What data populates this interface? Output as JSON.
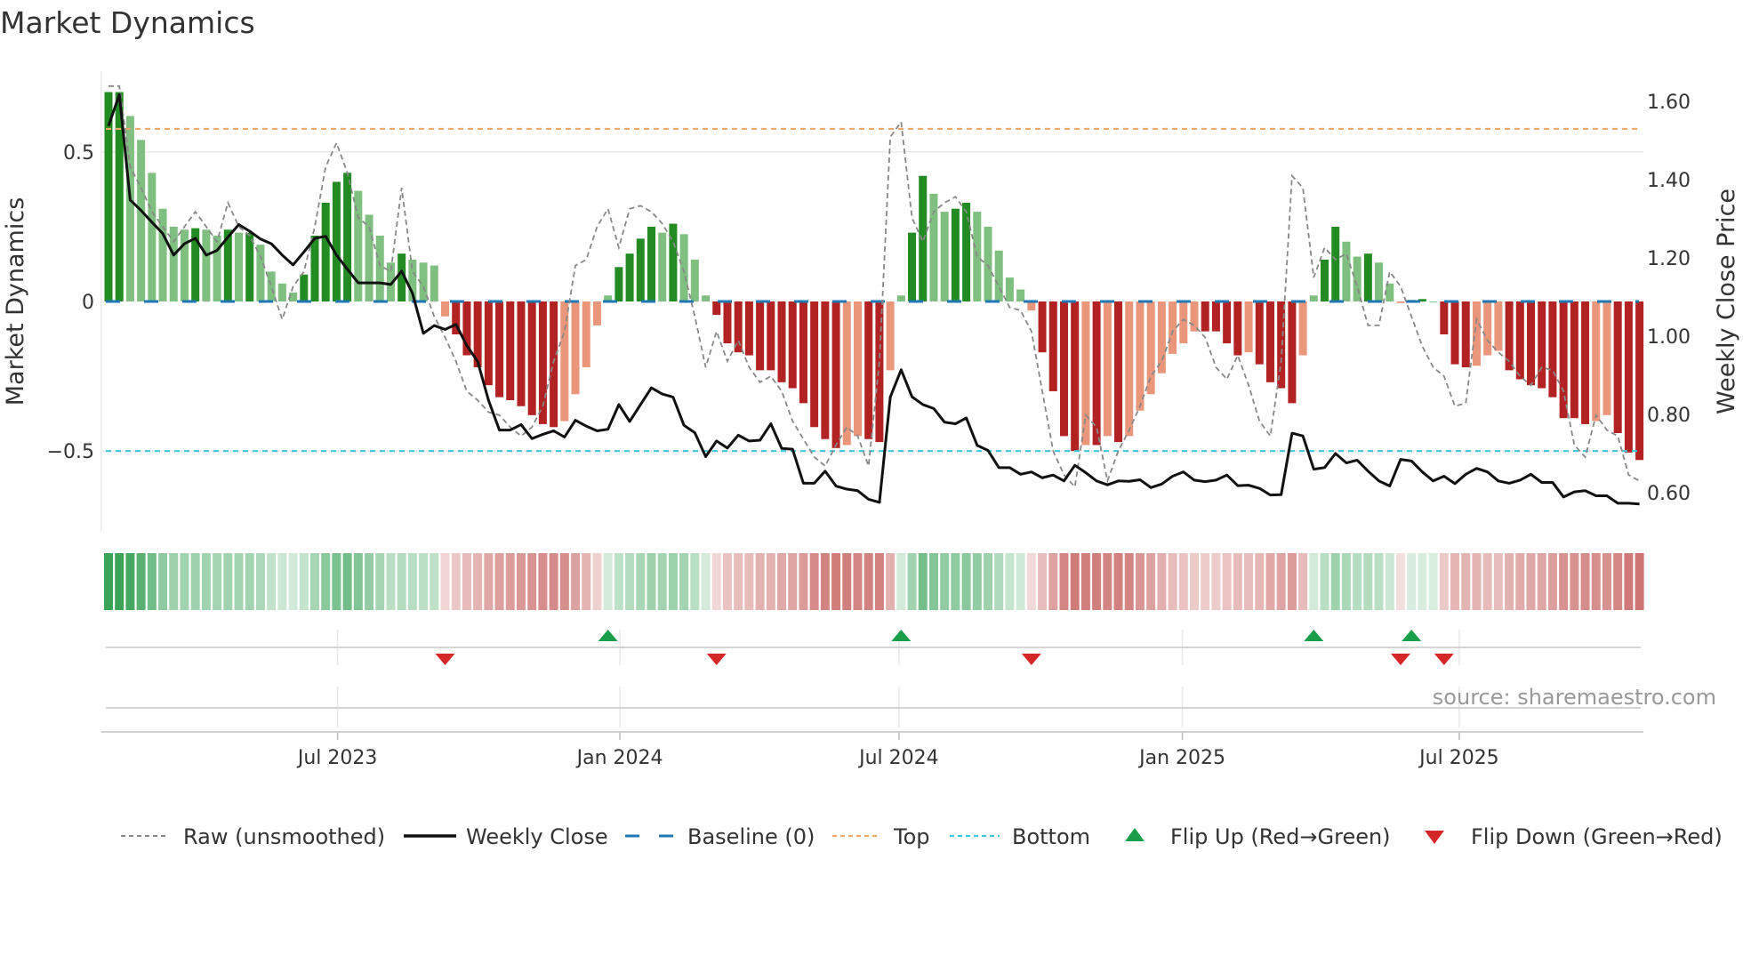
{
  "title": "Market Dynamics",
  "source": "source: sharemaestro.com",
  "colors": {
    "up_strong": "#228b22",
    "up_weak": "#7fbf7f",
    "down_strong": "#b22222",
    "down_weak": "#e9967a",
    "close": "#111111",
    "raw": "#888888",
    "baseline": "#1f77b4",
    "top": "#f0a868",
    "bottom": "#3cc8d8",
    "flip_up": "#1a9e4a",
    "flip_down": "#d62728",
    "strip_green": "#2e9e4f",
    "strip_red": "#c0504d"
  },
  "chart_data": {
    "type": "bar",
    "title": "Market Dynamics",
    "ylabel": "Market Dynamics",
    "ylabel_right": "Weekly Close Price",
    "ylim": [
      -0.77,
      0.77
    ],
    "ylim_right": [
      0.5,
      1.677
    ],
    "yticks": [
      {
        "value": 0.5,
        "label": "0.5"
      },
      {
        "value": 0,
        "label": "0"
      },
      {
        "value": -0.5,
        "label": "−0.5"
      }
    ],
    "yticks_right": [
      {
        "value": 1.6,
        "label": "1.60"
      },
      {
        "value": 1.4,
        "label": "1.40"
      },
      {
        "value": 1.2,
        "label": "1.20"
      },
      {
        "value": 1.0,
        "label": "1.00"
      },
      {
        "value": 0.8,
        "label": "0.80"
      },
      {
        "value": 0.6,
        "label": "0.60"
      }
    ],
    "x_unit": "week index",
    "x_ticks": [
      {
        "label": "Jul 2023",
        "week_index": 21.1
      },
      {
        "label": "Jan 2024",
        "week_index": 47.1
      },
      {
        "label": "Jul 2024",
        "week_index": 72.8
      },
      {
        "label": "Jan 2025",
        "week_index": 98.9
      },
      {
        "label": "Jul 2025",
        "week_index": 124.4
      }
    ],
    "top_level": 0.577,
    "bottom_level": -0.5,
    "baseline": 0,
    "dynamics": [
      0.7,
      0.7,
      0.62,
      0.54,
      0.43,
      0.31,
      0.25,
      0.24,
      0.245,
      0.24,
      0.22,
      0.24,
      0.23,
      0.23,
      0.19,
      0.1,
      0.06,
      0.03,
      0.09,
      0.22,
      0.33,
      0.4,
      0.43,
      0.37,
      0.29,
      0.22,
      0.13,
      0.16,
      0.14,
      0.13,
      0.12,
      -0.05,
      -0.11,
      -0.18,
      -0.22,
      -0.28,
      -0.32,
      -0.33,
      -0.35,
      -0.38,
      -0.41,
      -0.42,
      -0.4,
      -0.31,
      -0.22,
      -0.08,
      0.02,
      0.115,
      0.16,
      0.21,
      0.25,
      0.23,
      0.26,
      0.225,
      0.14,
      0.02,
      -0.045,
      -0.14,
      -0.17,
      -0.18,
      -0.23,
      -0.23,
      -0.27,
      -0.29,
      -0.34,
      -0.42,
      -0.46,
      -0.49,
      -0.48,
      -0.45,
      -0.46,
      -0.47,
      -0.23,
      0.02,
      0.23,
      0.42,
      0.36,
      0.3,
      0.31,
      0.33,
      0.3,
      0.25,
      0.17,
      0.08,
      0.04,
      -0.03,
      -0.17,
      -0.3,
      -0.45,
      -0.5,
      -0.48,
      -0.48,
      -0.45,
      -0.47,
      -0.45,
      -0.365,
      -0.31,
      -0.24,
      -0.175,
      -0.14,
      -0.1,
      -0.1,
      -0.1,
      -0.14,
      -0.18,
      -0.17,
      -0.21,
      -0.27,
      -0.29,
      -0.34,
      -0.18,
      0.02,
      0.14,
      0.25,
      0.2,
      0.15,
      0.16,
      0.13,
      0.06,
      -0.005,
      0.005,
      0.008,
      0,
      -0.11,
      -0.21,
      -0.22,
      -0.215,
      -0.18,
      -0.165,
      -0.23,
      -0.26,
      -0.28,
      -0.29,
      -0.32,
      -0.39,
      -0.39,
      -0.41,
      -0.4,
      -0.38,
      -0.44,
      -0.505,
      -0.53
    ],
    "raw": [
      0.72,
      0.72,
      0.45,
      0.38,
      0.3,
      0.25,
      0.2,
      0.25,
      0.3,
      0.25,
      0.2,
      0.33,
      0.25,
      0.22,
      0.15,
      0.05,
      -0.06,
      0.05,
      0.1,
      0.25,
      0.45,
      0.53,
      0.43,
      0.28,
      0.25,
      0.12,
      0.1,
      0.38,
      0.1,
      0.05,
      -0.05,
      -0.12,
      -0.2,
      -0.3,
      -0.33,
      -0.37,
      -0.38,
      -0.42,
      -0.45,
      -0.42,
      -0.35,
      -0.2,
      -0.1,
      0.12,
      0.14,
      0.25,
      0.31,
      0.18,
      0.31,
      0.32,
      0.3,
      0.26,
      0.2,
      0.1,
      -0.05,
      -0.22,
      -0.1,
      -0.2,
      -0.13,
      -0.22,
      -0.27,
      -0.25,
      -0.3,
      -0.4,
      -0.46,
      -0.52,
      -0.55,
      -0.48,
      -0.42,
      -0.45,
      -0.55,
      -0.2,
      0.55,
      0.6,
      0.28,
      0.2,
      0.3,
      0.33,
      0.35,
      0.3,
      0.15,
      0.12,
      0.05,
      -0.02,
      -0.03,
      -0.1,
      -0.3,
      -0.5,
      -0.58,
      -0.62,
      -0.38,
      -0.42,
      -0.6,
      -0.5,
      -0.43,
      -0.35,
      -0.25,
      -0.2,
      -0.1,
      -0.06,
      -0.08,
      -0.12,
      -0.22,
      -0.26,
      -0.18,
      -0.28,
      -0.4,
      -0.45,
      -0.2,
      0.42,
      0.38,
      0.08,
      0.18,
      0.14,
      0.16,
      0.05,
      -0.08,
      -0.08,
      0.1,
      0.05,
      -0.05,
      -0.15,
      -0.22,
      -0.25,
      -0.35,
      -0.34,
      -0.06,
      -0.13,
      -0.17,
      -0.2,
      -0.25,
      -0.28,
      -0.22,
      -0.23,
      -0.3,
      -0.48,
      -0.52,
      -0.38,
      -0.43,
      -0.45,
      -0.58,
      -0.6
    ],
    "weekly_close": [
      1.537,
      1.617,
      1.348,
      1.321,
      1.291,
      1.262,
      1.207,
      1.236,
      1.25,
      1.207,
      1.219,
      1.253,
      1.285,
      1.268,
      1.248,
      1.236,
      1.207,
      1.182,
      1.215,
      1.25,
      1.255,
      1.207,
      1.171,
      1.136,
      1.136,
      1.136,
      1.132,
      1.166,
      1.109,
      1.007,
      1.027,
      1.017,
      1.03,
      0.976,
      0.935,
      0.836,
      0.76,
      0.76,
      0.774,
      0.738,
      0.749,
      0.758,
      0.742,
      0.785,
      0.77,
      0.758,
      0.762,
      0.825,
      0.782,
      0.825,
      0.868,
      0.852,
      0.844,
      0.772,
      0.753,
      0.692,
      0.732,
      0.714,
      0.747,
      0.732,
      0.734,
      0.776,
      0.713,
      0.711,
      0.624,
      0.624,
      0.655,
      0.617,
      0.609,
      0.605,
      0.583,
      0.575,
      0.844,
      0.914,
      0.845,
      0.825,
      0.815,
      0.78,
      0.776,
      0.791,
      0.721,
      0.708,
      0.664,
      0.664,
      0.647,
      0.653,
      0.638,
      0.645,
      0.63,
      0.67,
      0.651,
      0.63,
      0.62,
      0.63,
      0.629,
      0.633,
      0.613,
      0.622,
      0.642,
      0.653,
      0.632,
      0.628,
      0.632,
      0.645,
      0.618,
      0.619,
      0.611,
      0.594,
      0.595,
      0.752,
      0.745,
      0.66,
      0.664,
      0.7,
      0.676,
      0.683,
      0.655,
      0.63,
      0.617,
      0.685,
      0.681,
      0.653,
      0.63,
      0.642,
      0.623,
      0.647,
      0.662,
      0.653,
      0.63,
      0.624,
      0.632,
      0.647,
      0.626,
      0.626,
      0.589,
      0.602,
      0.605,
      0.592,
      0.592,
      0.573,
      0.573,
      0.571
    ],
    "flip_up_weeks": [
      46,
      73,
      111,
      120
    ],
    "flip_down_weeks": [
      31,
      56,
      85,
      119,
      123
    ],
    "legend": {
      "placement": "bottom",
      "raw": "Raw (unsmoothed)",
      "close": "Weekly Close",
      "baseline": "Baseline (0)",
      "top": "Top",
      "bottom": "Bottom",
      "flip_up": "Flip Up (Red→Green)",
      "flip_down": "Flip Down (Green→Red)"
    }
  }
}
